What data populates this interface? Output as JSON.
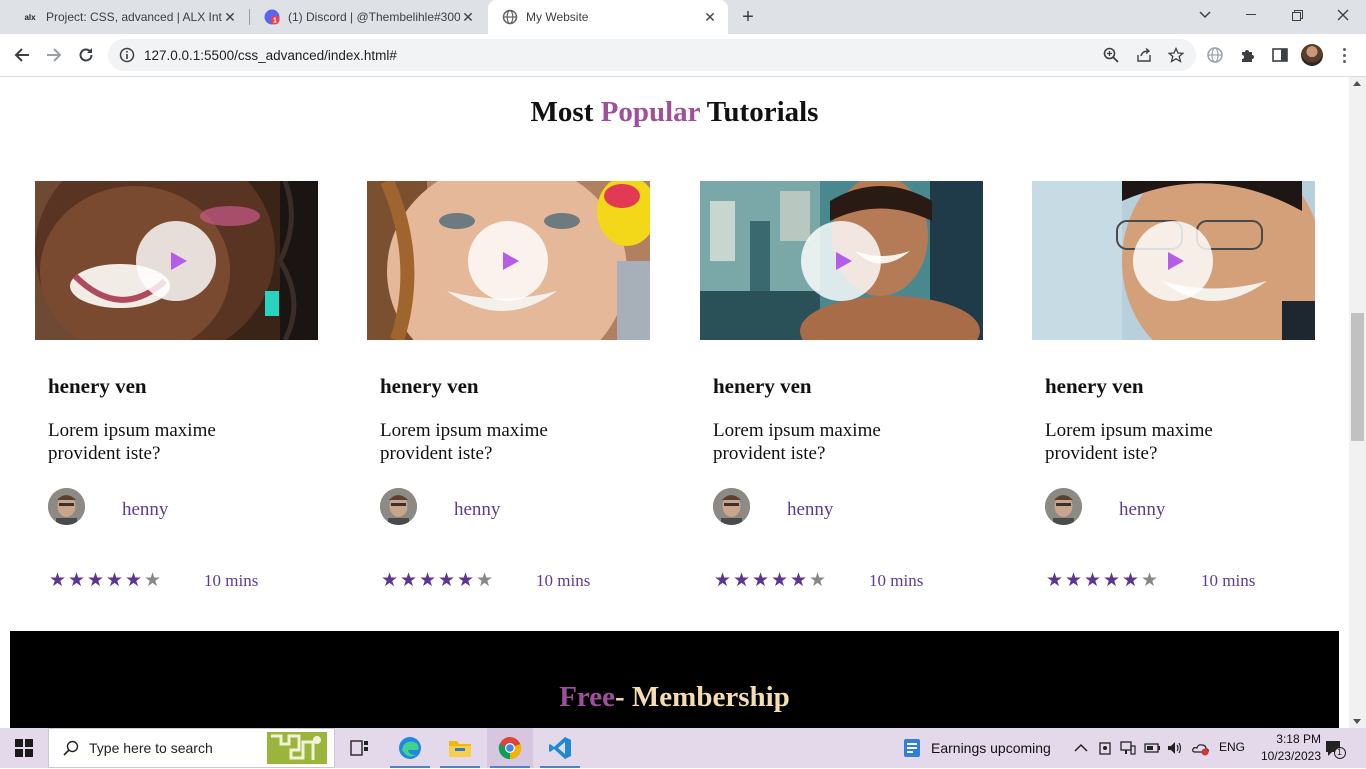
{
  "browser": {
    "tabs": [
      {
        "title": "Project: CSS, advanced | ALX Intr",
        "favicon": "alx-icon",
        "favicon_text": "alx"
      },
      {
        "title": "(1) Discord | @Thembelihle#300",
        "favicon": "discord-icon"
      },
      {
        "title": "My Website",
        "favicon": "globe-icon",
        "active": true
      }
    ],
    "url": "127.0.0.1:5500/css_advanced/index.html#",
    "new_tab_label": "+"
  },
  "page": {
    "section_title": {
      "pre": "Most ",
      "accent": "Popular",
      "post": " Tutorials"
    },
    "cards": [
      {
        "title": "henery ven",
        "description": "Lorem ipsum maxime provident iste?",
        "author": "henny",
        "rating": 5,
        "max_rating": 6,
        "duration": "10 mins"
      },
      {
        "title": "henery ven",
        "description": "Lorem ipsum maxime provident iste?",
        "author": "henny",
        "rating": 5,
        "max_rating": 6,
        "duration": "10 mins"
      },
      {
        "title": "henery ven",
        "description": "Lorem ipsum maxime provident iste?",
        "author": "henny",
        "rating": 5,
        "max_rating": 6,
        "duration": "10 mins"
      },
      {
        "title": "henery ven",
        "description": "Lorem ipsum maxime provident iste?",
        "author": "henny",
        "rating": 5,
        "max_rating": 6,
        "duration": "10 mins"
      }
    ],
    "membership": {
      "free": "Free",
      "rest": "- Membership"
    }
  },
  "taskbar": {
    "search_placeholder": "Type here to search",
    "news_widget": "Earnings upcoming",
    "language": "ENG",
    "time": "3:18 PM",
    "date": "10/23/2023",
    "notification_count": "1"
  },
  "colors": {
    "accent_purple": "#a0509b",
    "star_purple": "#5b3596",
    "link_purple": "#5e3c93",
    "membership_gold": "#f4ddb0"
  }
}
